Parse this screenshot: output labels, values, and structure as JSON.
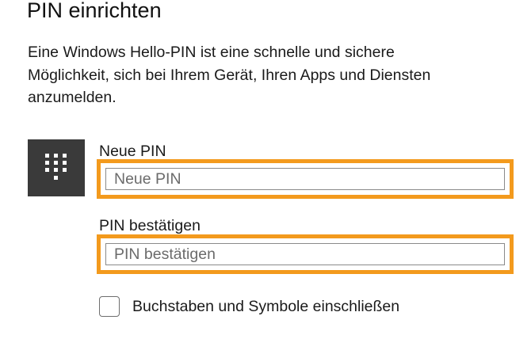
{
  "dialog": {
    "title": "PIN einrichten",
    "description": "Eine Windows Hello-PIN ist eine schnelle und sichere Möglichkeit, sich bei Ihrem Gerät, Ihren Apps und Diensten anzumelden.",
    "keypad_icon": "keypad-icon"
  },
  "new_pin": {
    "label": "Neue PIN",
    "placeholder": "Neue PIN",
    "value": ""
  },
  "confirm_pin": {
    "label": "PIN bestätigen",
    "placeholder": "PIN bestätigen",
    "value": ""
  },
  "include_letters": {
    "label": "Buchstaben und Symbole einschließen",
    "checked": false
  },
  "colors": {
    "highlight": "#f39a1d",
    "tile": "#3a3a3a"
  }
}
